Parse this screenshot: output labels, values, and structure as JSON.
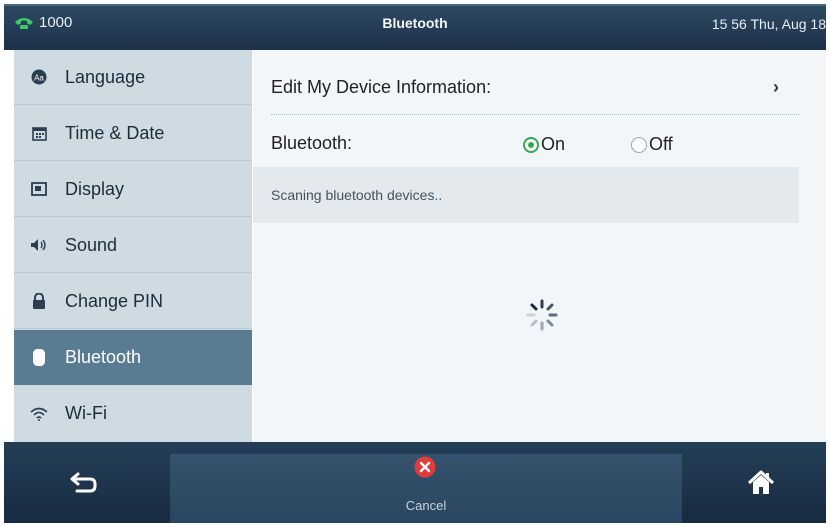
{
  "status_bar": {
    "account": "1000",
    "title": "Bluetooth",
    "clock": "15 56 Thu, Aug 18"
  },
  "sidebar": {
    "items": [
      {
        "label": "Language",
        "icon": "language-icon"
      },
      {
        "label": "Time & Date",
        "icon": "calendar-icon"
      },
      {
        "label": "Display",
        "icon": "display-icon"
      },
      {
        "label": "Sound",
        "icon": "speaker-icon"
      },
      {
        "label": "Change PIN",
        "icon": "lock-icon"
      },
      {
        "label": "Bluetooth",
        "icon": "bluetooth-icon",
        "active": true
      },
      {
        "label": "Wi-Fi",
        "icon": "wifi-icon"
      }
    ]
  },
  "main": {
    "edit_device_label": "Edit My Device Information:",
    "bluetooth_label": "Bluetooth:",
    "option_on": "On",
    "option_off": "Off",
    "selected": "On",
    "scan_status": "Scaning bluetooth devices.."
  },
  "bottom_bar": {
    "cancel_label": "Cancel"
  },
  "colors": {
    "accent_green": "#2faa52",
    "active_item": "#5a7c93",
    "cancel_red": "#e23b3b"
  }
}
